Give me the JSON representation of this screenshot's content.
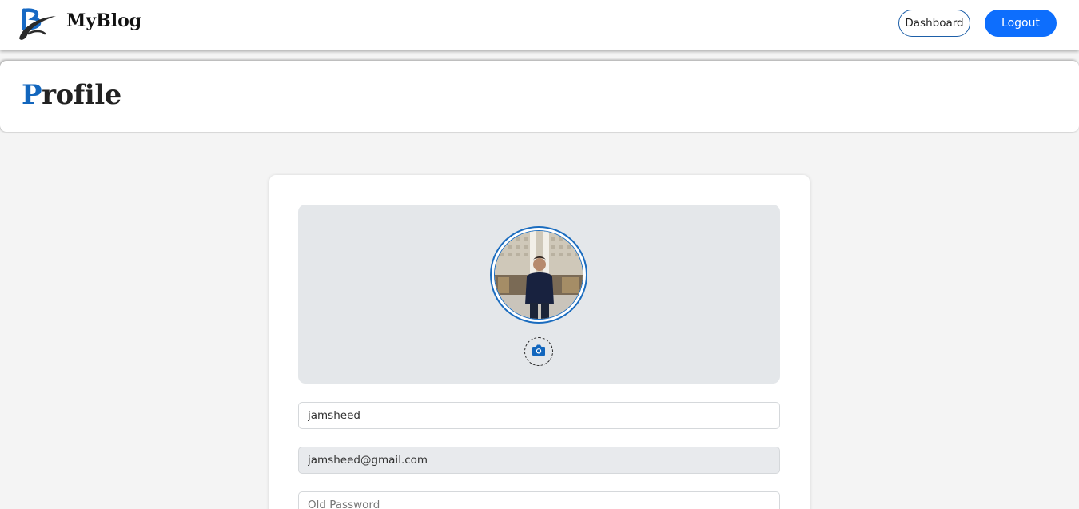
{
  "navbar": {
    "brand": "MyBlog",
    "dashboard_label": "Dashboard",
    "logout_label": "Logout"
  },
  "header": {
    "title_first_letter": "P",
    "title_rest": "rofile"
  },
  "profile": {
    "username_value": "jamsheed",
    "email_value": "jamsheed@gmail.com",
    "old_password_placeholder": "Old Password"
  },
  "colors": {
    "accent": "#0d6efd",
    "title_accent": "#1266bd",
    "page_background": "#f4f4f4",
    "photo_panel_background": "#e4e7ea"
  },
  "icons": {
    "logo": "myblog-logo",
    "camera": "camera-icon"
  }
}
